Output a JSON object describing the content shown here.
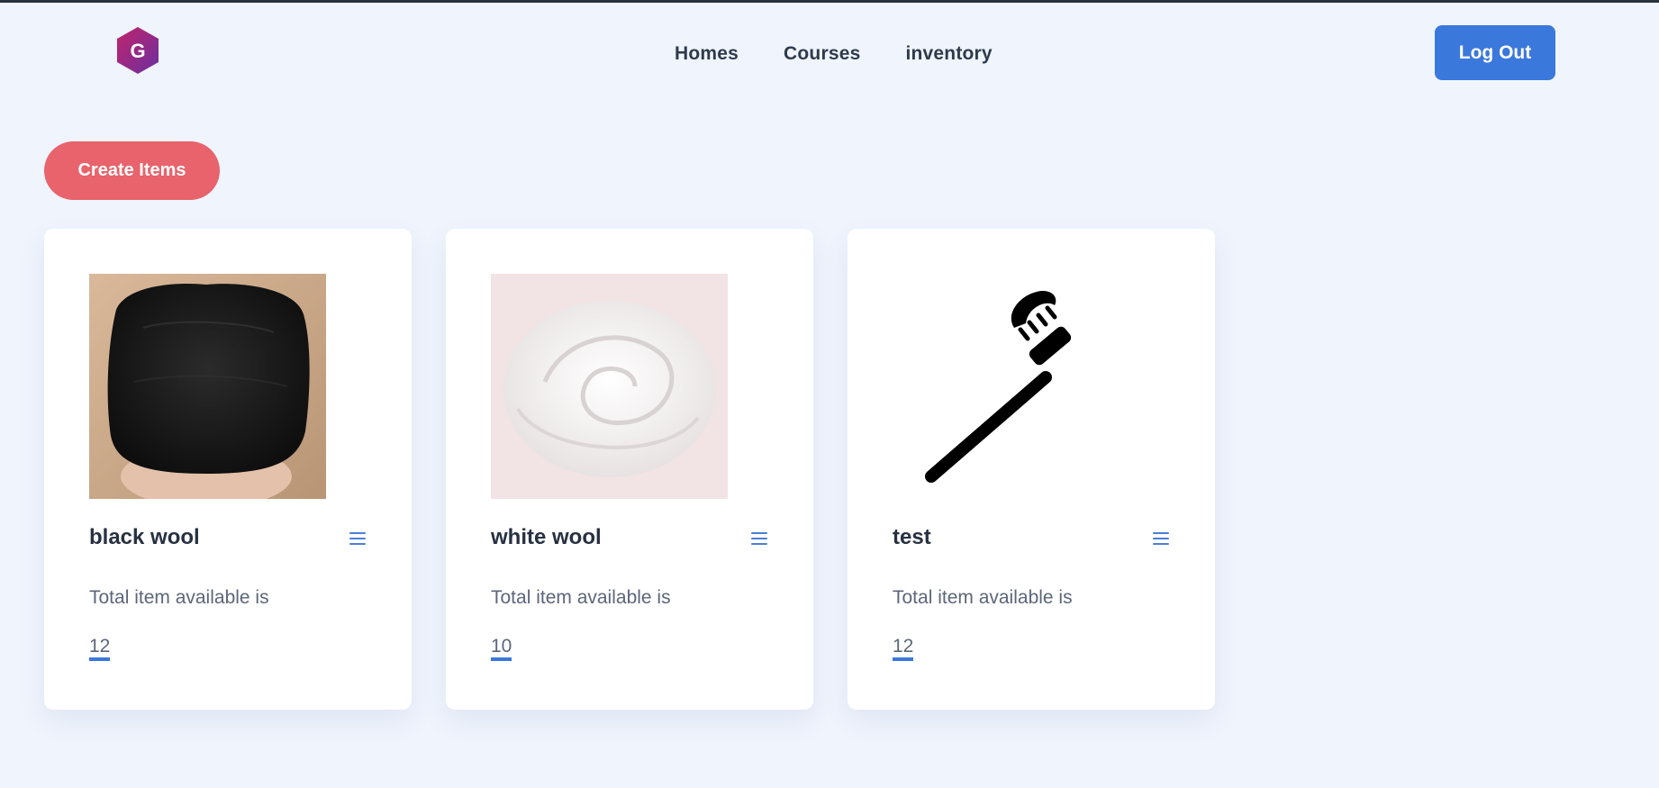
{
  "header": {
    "logo_letter": "G",
    "nav": [
      "Homes",
      "Courses",
      "inventory"
    ],
    "logout_label": "Log Out"
  },
  "actions": {
    "create_label": "Create Items"
  },
  "items": [
    {
      "name": "black wool",
      "desc": "Total item available is",
      "count": "12",
      "image": "black-wool-photo"
    },
    {
      "name": "white wool",
      "desc": "Total item available is",
      "count": "10",
      "image": "white-wool-photo"
    },
    {
      "name": "test",
      "desc": "Total item available is",
      "count": "12",
      "image": "toothbrush-icon"
    }
  ],
  "colors": {
    "background": "#eff4fd",
    "primary": "#3b78dc",
    "create": "#e8636b",
    "card": "#ffffff"
  }
}
